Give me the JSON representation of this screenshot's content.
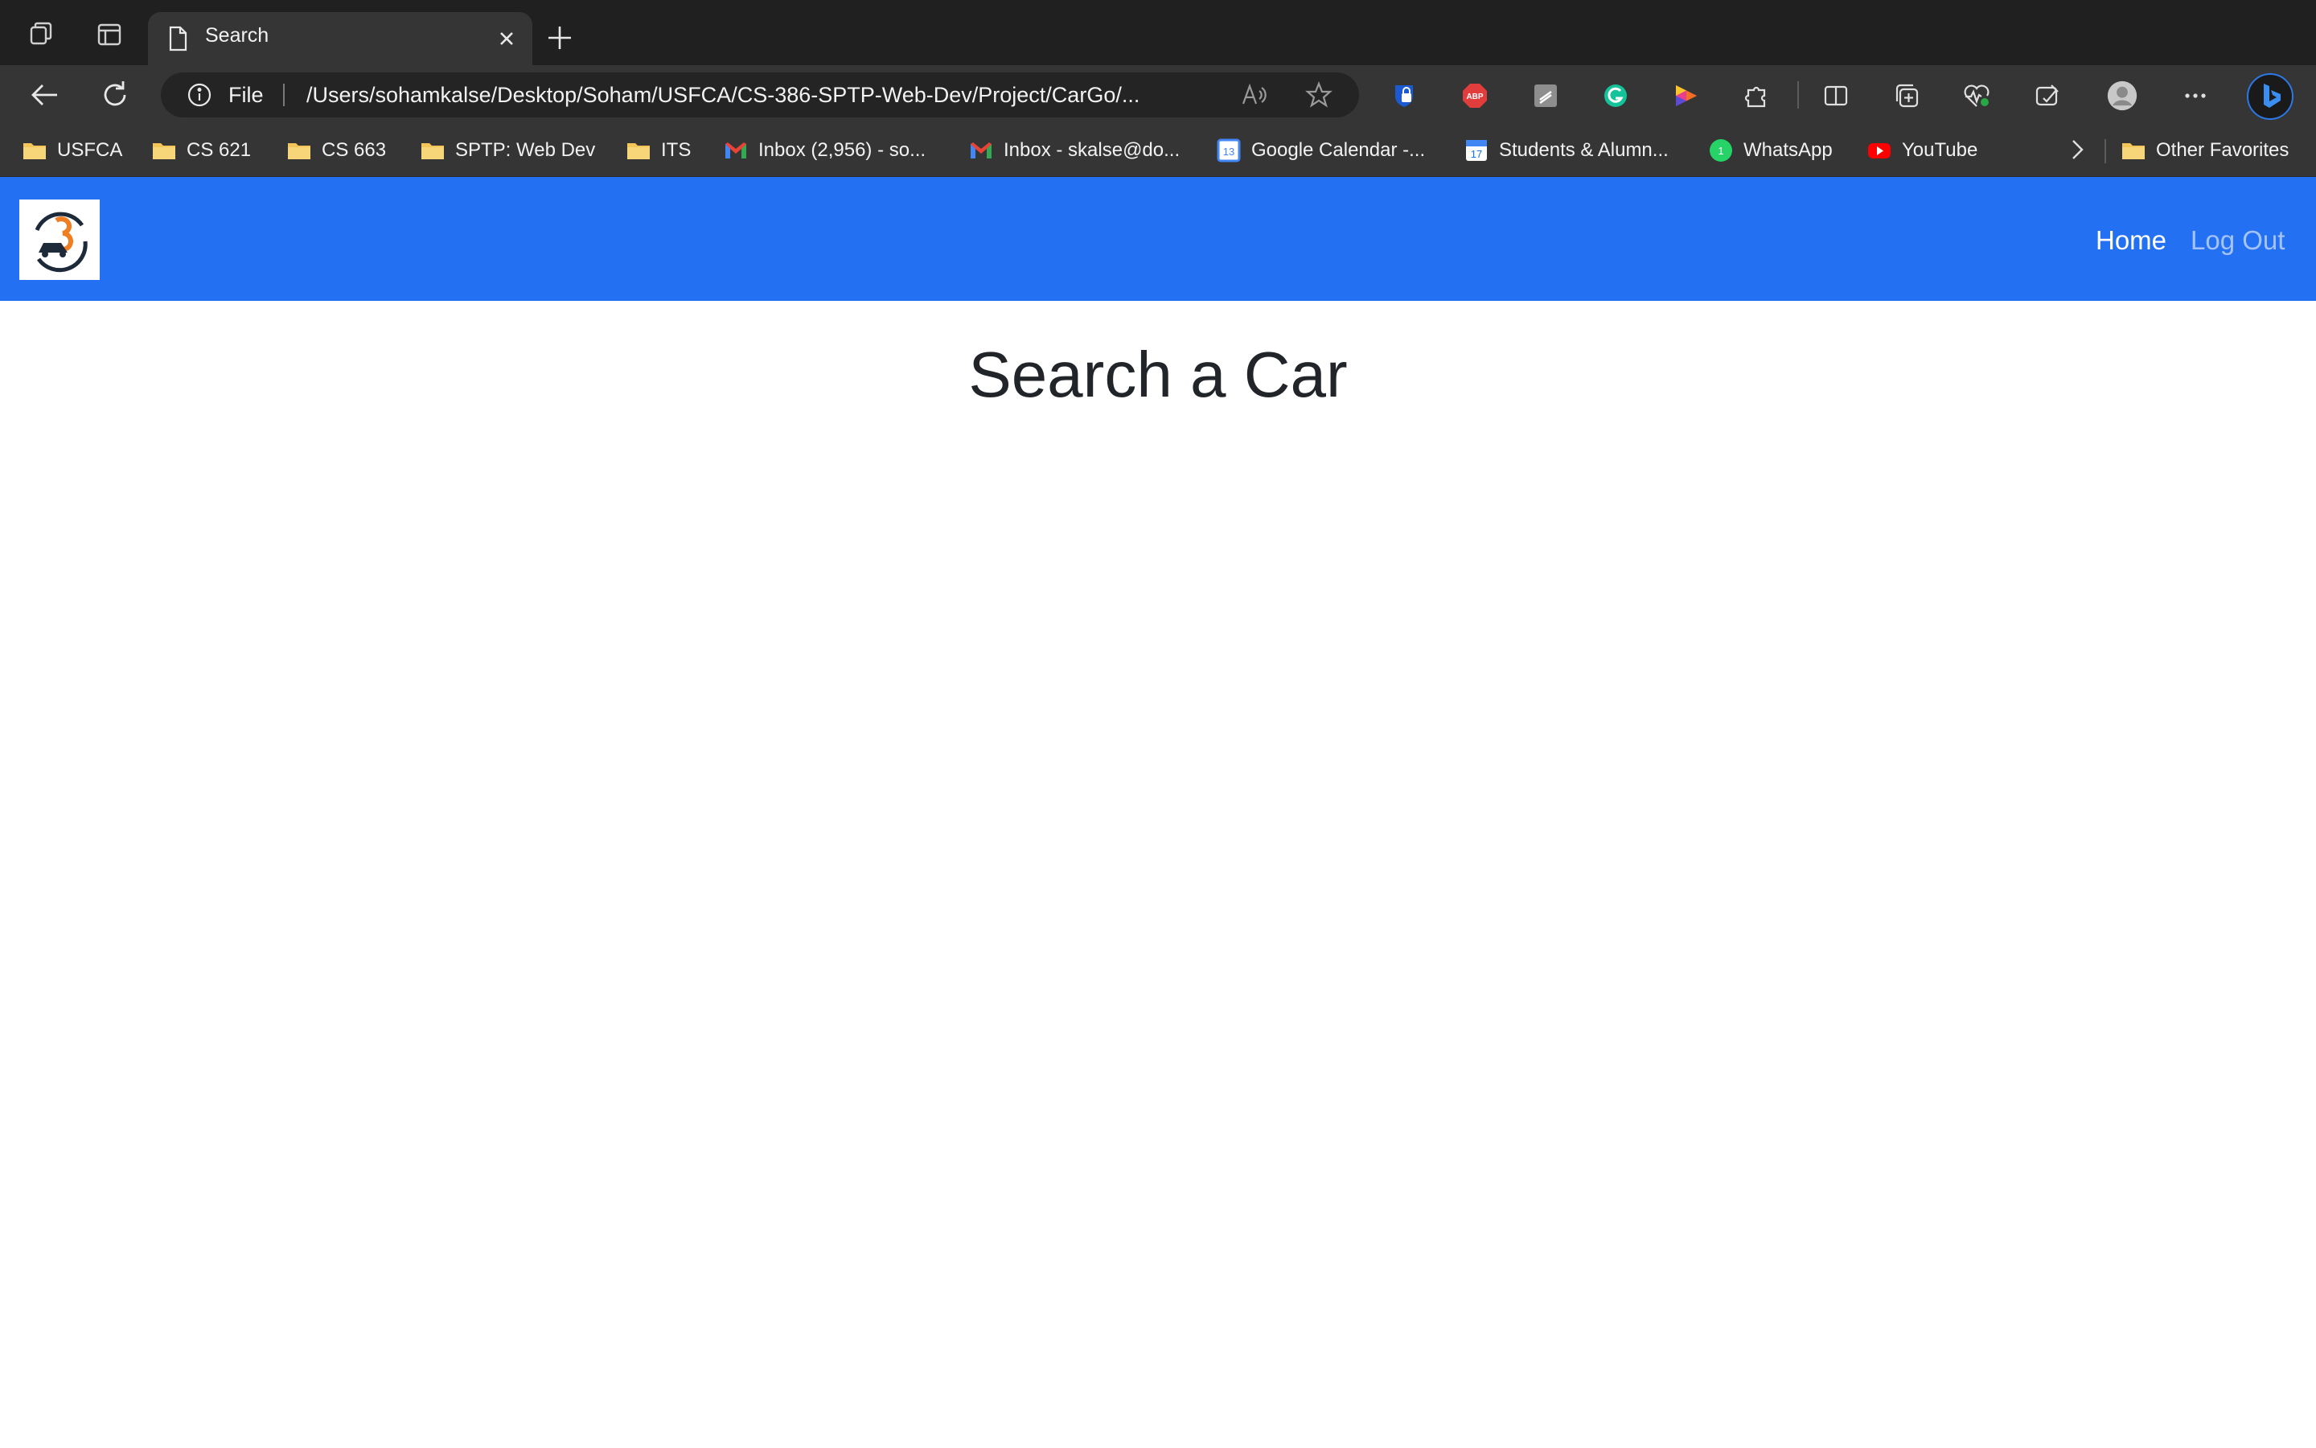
{
  "browser": {
    "tab": {
      "title": "Search",
      "favicon": "page-icon"
    },
    "address_bar": {
      "scheme_label": "File",
      "url": "/Users/sohamkalse/Desktop/Soham/USFCA/CS-386-SPTP-Web-Dev/Project/CarGo/..."
    },
    "extensions": [
      "bitwarden-icon",
      "adblock-plus-icon",
      "extension-gray-icon",
      "grammarly-icon",
      "color-picker-icon",
      "puzzle-icon",
      "split-screen-icon",
      "collections-icon",
      "heartbeat-icon",
      "browser-essentials-icon",
      "profile-icon",
      "more-icon",
      "bing-copilot-icon"
    ],
    "bookmarks": [
      {
        "label": "USFCA",
        "icon": "folder-icon"
      },
      {
        "label": "CS 621",
        "icon": "folder-icon"
      },
      {
        "label": "CS 663",
        "icon": "folder-icon"
      },
      {
        "label": "SPTP: Web Dev",
        "icon": "folder-icon"
      },
      {
        "label": "ITS",
        "icon": "folder-icon"
      },
      {
        "label": "Inbox (2,956) - so...",
        "icon": "gmail-icon"
      },
      {
        "label": "Inbox - skalse@do...",
        "icon": "gmail-icon"
      },
      {
        "label": "Google Calendar -...",
        "icon": "calendar-13-icon",
        "badge": "13"
      },
      {
        "label": "Students & Alumn...",
        "icon": "calendar-17-icon",
        "badge": "17"
      },
      {
        "label": "WhatsApp",
        "icon": "whatsapp-icon",
        "badge": "1"
      },
      {
        "label": "YouTube",
        "icon": "youtube-icon"
      },
      {
        "label": "Other Favorites",
        "icon": "folder-icon"
      }
    ]
  },
  "site": {
    "nav": {
      "home": "Home",
      "logout": "Log Out"
    },
    "page_title": "Search a Car"
  },
  "colors": {
    "navbar": "#2470f2",
    "chrome_dark": "#202020",
    "chrome_toolbar": "#353535",
    "title_text": "#212529"
  }
}
